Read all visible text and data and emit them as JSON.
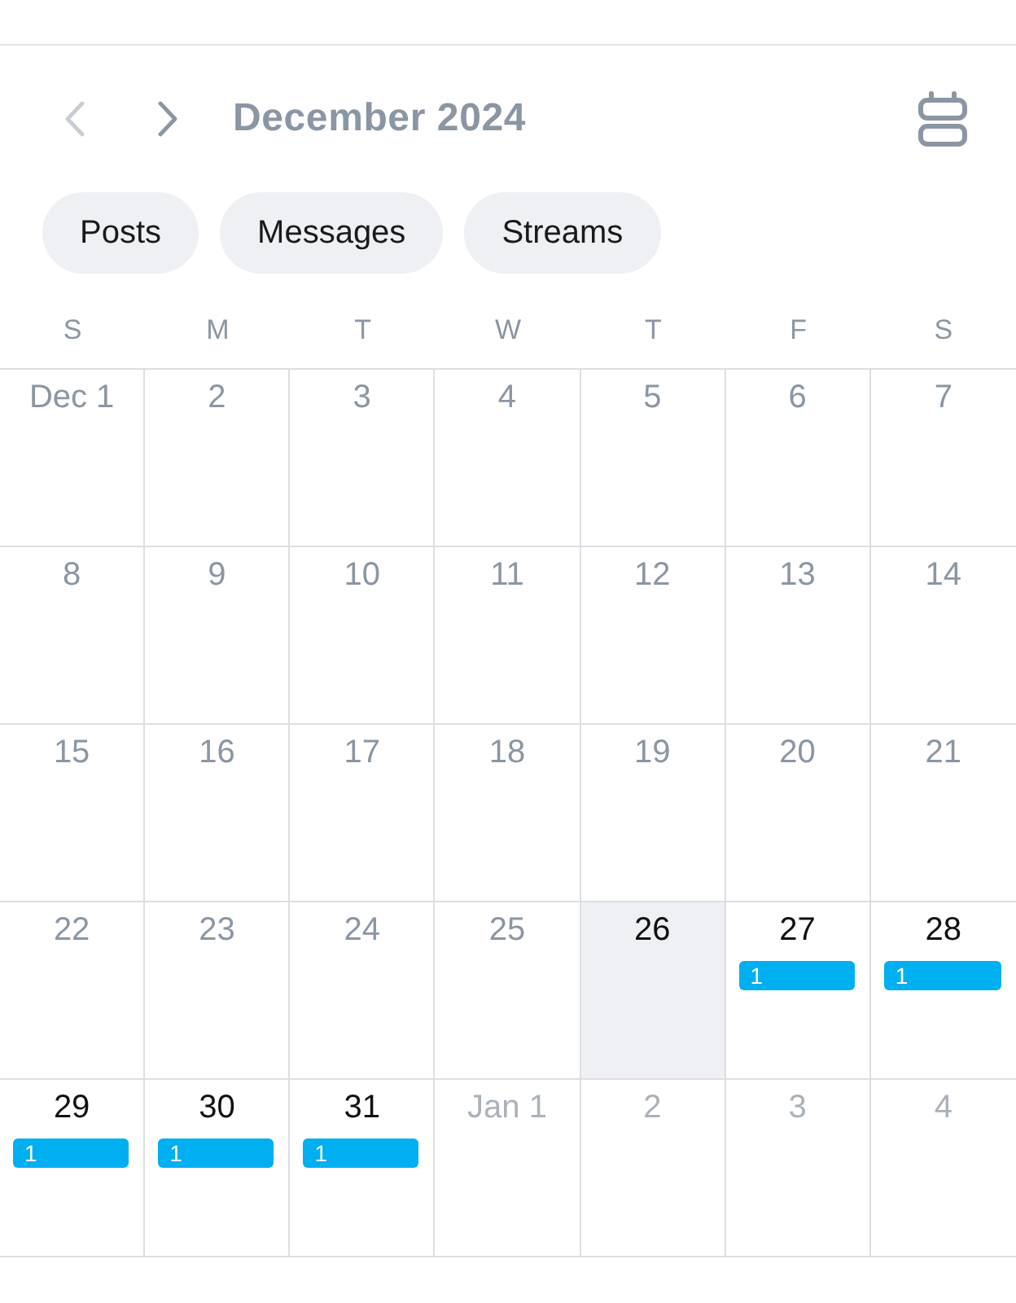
{
  "header": {
    "title": "December 2024",
    "previous_button": {
      "disabled": true
    },
    "next_button": {
      "disabled": false
    }
  },
  "filters": [
    {
      "label": "Posts",
      "selected": false
    },
    {
      "label": "Messages",
      "selected": false
    },
    {
      "label": "Streams",
      "selected": false
    }
  ],
  "weekdays": [
    "S",
    "M",
    "T",
    "W",
    "T",
    "F",
    "S"
  ],
  "weeks": [
    {
      "days": [
        {
          "label": "Dec 1",
          "kind": "past"
        },
        {
          "label": "2",
          "kind": "past"
        },
        {
          "label": "3",
          "kind": "past"
        },
        {
          "label": "4",
          "kind": "past"
        },
        {
          "label": "5",
          "kind": "past"
        },
        {
          "label": "6",
          "kind": "past"
        },
        {
          "label": "7",
          "kind": "past"
        }
      ]
    },
    {
      "days": [
        {
          "label": "8",
          "kind": "past"
        },
        {
          "label": "9",
          "kind": "past"
        },
        {
          "label": "10",
          "kind": "past"
        },
        {
          "label": "11",
          "kind": "past"
        },
        {
          "label": "12",
          "kind": "past"
        },
        {
          "label": "13",
          "kind": "past"
        },
        {
          "label": "14",
          "kind": "past"
        }
      ]
    },
    {
      "days": [
        {
          "label": "15",
          "kind": "past"
        },
        {
          "label": "16",
          "kind": "past"
        },
        {
          "label": "17",
          "kind": "past"
        },
        {
          "label": "18",
          "kind": "past"
        },
        {
          "label": "19",
          "kind": "past"
        },
        {
          "label": "20",
          "kind": "past"
        },
        {
          "label": "21",
          "kind": "past"
        }
      ]
    },
    {
      "days": [
        {
          "label": "22",
          "kind": "past"
        },
        {
          "label": "23",
          "kind": "past"
        },
        {
          "label": "24",
          "kind": "past"
        },
        {
          "label": "25",
          "kind": "past"
        },
        {
          "label": "26",
          "kind": "today"
        },
        {
          "label": "27",
          "kind": "upcoming",
          "events": [
            {
              "label": "1"
            }
          ]
        },
        {
          "label": "28",
          "kind": "upcoming",
          "events": [
            {
              "label": "1"
            }
          ]
        }
      ]
    },
    {
      "days": [
        {
          "label": "29",
          "kind": "upcoming",
          "events": [
            {
              "label": "1"
            }
          ]
        },
        {
          "label": "30",
          "kind": "upcoming",
          "events": [
            {
              "label": "1"
            }
          ]
        },
        {
          "label": "31",
          "kind": "upcoming",
          "events": [
            {
              "label": "1"
            }
          ]
        },
        {
          "label": "Jan 1",
          "kind": "next_month"
        },
        {
          "label": "2",
          "kind": "next_month"
        },
        {
          "label": "3",
          "kind": "next_month"
        },
        {
          "label": "4",
          "kind": "next_month"
        }
      ]
    }
  ]
}
